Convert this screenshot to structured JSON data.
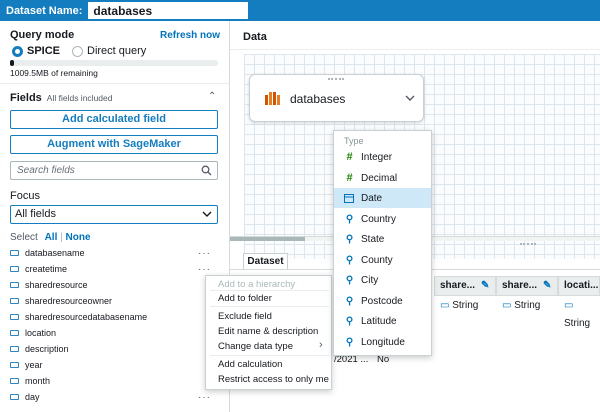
{
  "topbar": {
    "label": "Dataset Name:",
    "name_value": "databases"
  },
  "left": {
    "query_mode_title": "Query mode",
    "refresh_label": "Refresh now",
    "mode_spice": "SPICE",
    "mode_direct": "Direct query",
    "spice_remaining": "1009.5MB of remaining",
    "fields_title": "Fields",
    "fields_status": "All fields included",
    "add_calc_label": "Add calculated field",
    "augment_label": "Augment with SageMaker",
    "search_placeholder": "Search fields",
    "focus_title": "Focus",
    "focus_value": "All fields",
    "select_label": "Select",
    "select_all": "All",
    "select_none": "None",
    "fields": [
      "databasename",
      "createtime",
      "sharedresource",
      "sharedresourceowner",
      "sharedresourcedatabasename",
      "location",
      "description",
      "year",
      "month",
      "day"
    ]
  },
  "right": {
    "data_title": "Data",
    "node_label": "databases",
    "dataset_tab": "Dataset",
    "columns": [
      "share...",
      "share...",
      "locati..."
    ],
    "column_type": "String",
    "peek_text": "/2021 ...",
    "peek_value": "No"
  },
  "context_menu": {
    "items": [
      "Add to a hierarchy",
      "Add to folder",
      "Exclude field",
      "Edit name & description",
      "Change data type",
      "Add calculation",
      "Restrict access to only me"
    ]
  },
  "type_menu": {
    "header": "Type",
    "items": [
      {
        "label": "Integer",
        "icon": "hash-icon"
      },
      {
        "label": "Decimal",
        "icon": "hash-icon"
      },
      {
        "label": "Date",
        "icon": "calendar-icon"
      },
      {
        "label": "Country",
        "icon": "map-pin-icon"
      },
      {
        "label": "State",
        "icon": "map-pin-icon"
      },
      {
        "label": "County",
        "icon": "map-pin-icon"
      },
      {
        "label": "City",
        "icon": "map-pin-icon"
      },
      {
        "label": "Postcode",
        "icon": "map-pin-icon"
      },
      {
        "label": "Latitude",
        "icon": "map-pin-icon"
      },
      {
        "label": "Longitude",
        "icon": "map-pin-icon"
      }
    ],
    "selected": "Date"
  },
  "colors": {
    "accent": "#147dbf",
    "link": "#0073bb",
    "highlight": "#cfe8f7",
    "measure": "#1d8102",
    "brand_orange": "#d35400"
  }
}
